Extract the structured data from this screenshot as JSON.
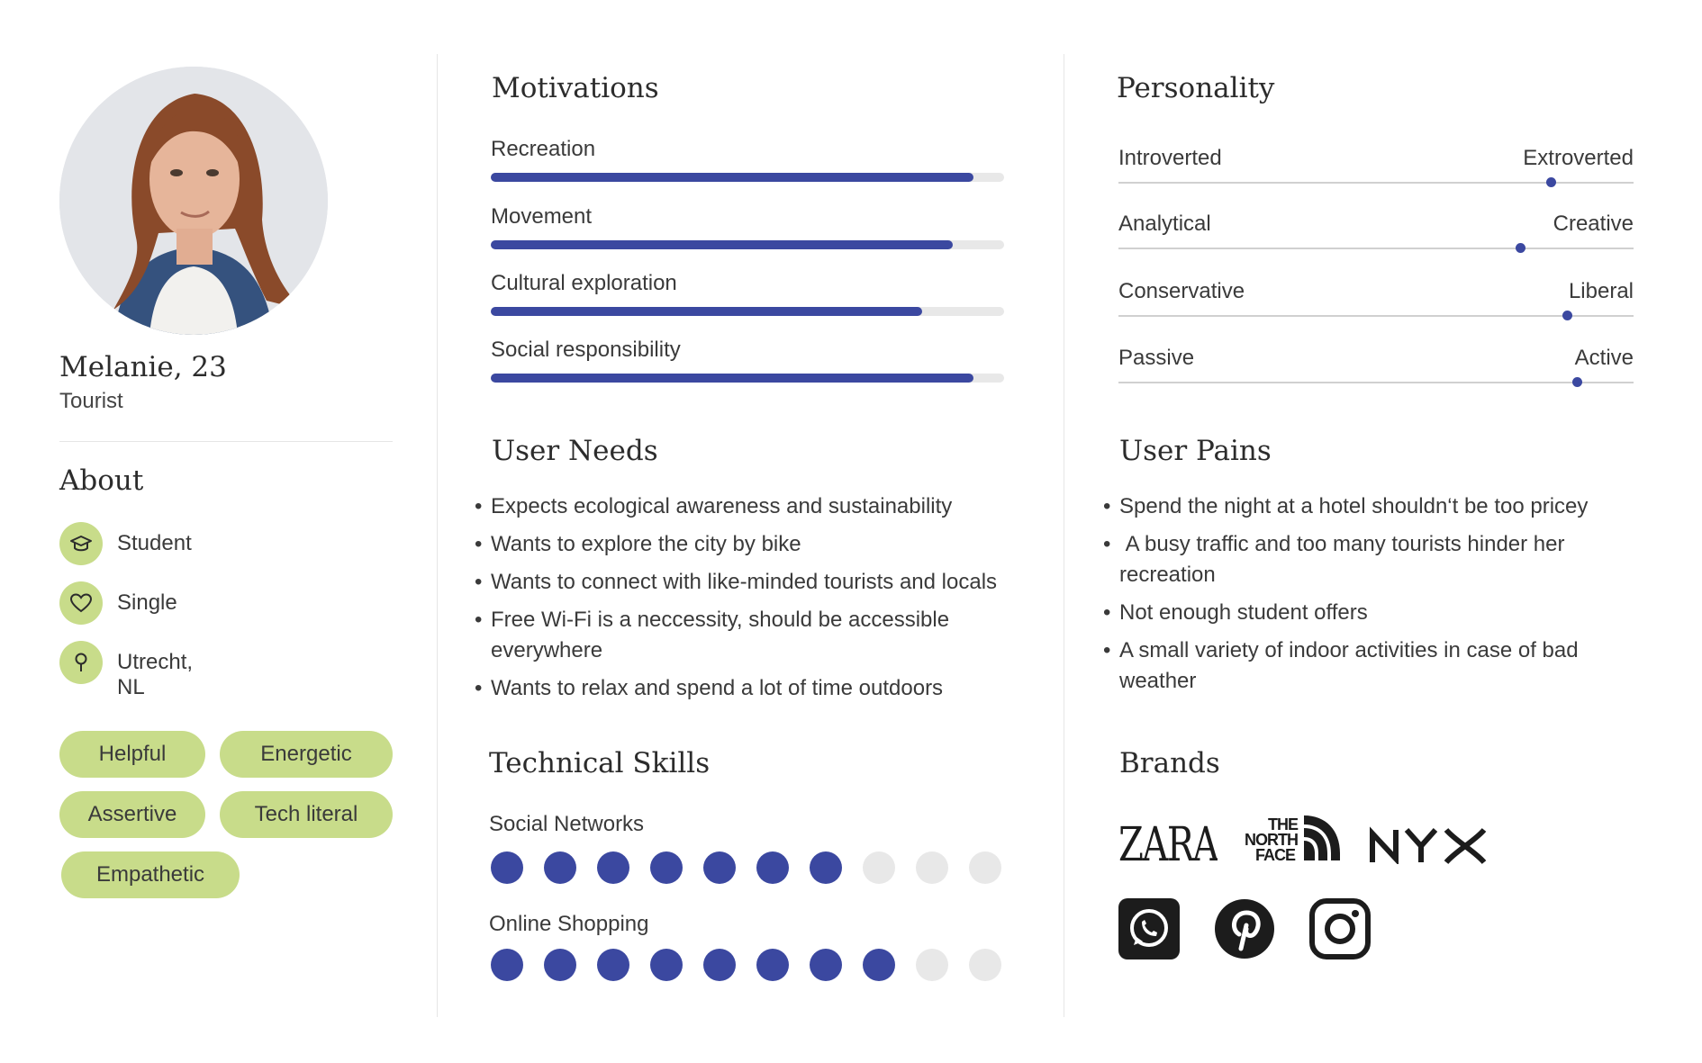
{
  "profile": {
    "name": "Melanie, 23",
    "role": "Tourist"
  },
  "about": {
    "title": "About",
    "items": [
      {
        "icon": "graduation-cap-icon",
        "label": "Student"
      },
      {
        "icon": "heart-icon",
        "label": "Single"
      },
      {
        "icon": "location-pin-icon",
        "label": "Utrecht, NL"
      }
    ]
  },
  "tags": [
    "Helpful",
    "Energetic",
    "Assertive",
    "Tech literal",
    "Empathetic"
  ],
  "motivations": {
    "title": "Motivations",
    "items": [
      {
        "label": "Recreation",
        "level": 0.94
      },
      {
        "label": "Movement",
        "level": 0.9
      },
      {
        "label": "Cultural exploration",
        "level": 0.84
      },
      {
        "label": "Social responsibility",
        "level": 0.94
      }
    ]
  },
  "user_needs": {
    "title": "User Needs",
    "items": [
      "Expects ecological awareness and sustainability",
      "Wants to explore the city by bike",
      "Wants to connect with like-minded tourists and locals",
      "Free Wi-Fi is a neccessity,  should be accessible everywhere",
      "Wants to relax and spend a lot of time outdoors"
    ]
  },
  "technical_skills": {
    "title": "Technical Skills",
    "items": [
      {
        "label": "Social Networks",
        "rating": 7,
        "max": 10
      },
      {
        "label": "Online Shopping",
        "rating": 8,
        "max": 10
      }
    ]
  },
  "personality": {
    "title": "Personality",
    "items": [
      {
        "left": "Introverted",
        "right": "Extroverted",
        "value": 0.84
      },
      {
        "left": "Analytical",
        "right": "Creative",
        "value": 0.78
      },
      {
        "left": "Conservative",
        "right": "Liberal",
        "value": 0.87
      },
      {
        "left": "Passive",
        "right": "Active",
        "value": 0.89
      }
    ]
  },
  "user_pains": {
    "title": "User Pains",
    "items": [
      "Spend the night at a hotel shouldn‘t be too pricey",
      " A busy traffic and too many tourists hinder her recreation",
      "Not enough student offers",
      "A small variety of indoor activities in case of bad weather"
    ]
  },
  "brands": {
    "title": "Brands",
    "logos": [
      "ZARA",
      "THE NORTH FACE",
      "NYX"
    ],
    "apps": [
      "whatsapp-icon",
      "pinterest-icon",
      "instagram-icon"
    ]
  },
  "colors": {
    "accent": "#3b48a0",
    "tag_bg": "#c8dc8a",
    "track": "#e8e8e8",
    "empty_dot": "#e8e8e8"
  }
}
